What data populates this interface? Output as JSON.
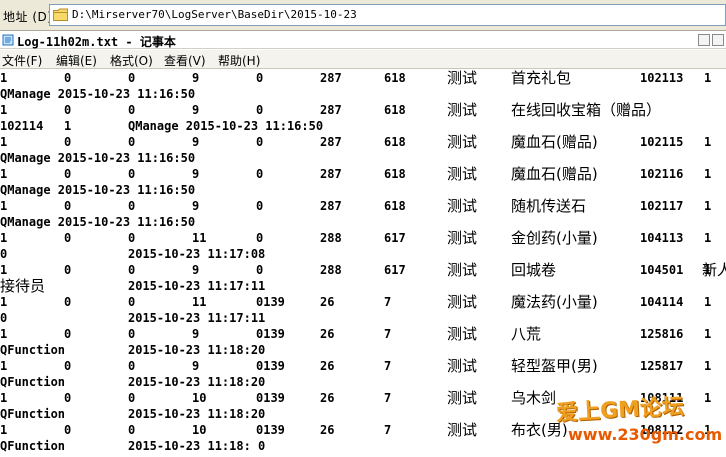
{
  "address_bar": {
    "label": "地址 (D)",
    "path": "D:\\Mirserver70\\LogServer\\BaseDir\\2015-10-23"
  },
  "window": {
    "title": "Log-11h02m.txt - 记事本"
  },
  "menu": [
    {
      "label": "文件(F)"
    },
    {
      "label": "编辑(E)"
    },
    {
      "label": "格式(O)"
    },
    {
      "label": "查看(V)"
    },
    {
      "label": "帮助(H)"
    }
  ],
  "lines": [
    [
      "1",
      "0",
      "0",
      "9",
      "0",
      "287",
      "618",
      "测试",
      "首充礼包",
      "102113",
      "1"
    ],
    [
      "QManage 2015-10-23 11:16:50"
    ],
    [
      "1",
      "0",
      "0",
      "9",
      "0",
      "287",
      "618",
      "测试",
      "在线回收宝箱（赠品）"
    ],
    [
      "102114",
      "1",
      "QManage 2015-10-23 11:16:50"
    ],
    [
      "1",
      "0",
      "0",
      "9",
      "0",
      "287",
      "618",
      "测试",
      "魔血石(赠品)",
      "102115",
      "1"
    ],
    [
      "QManage 2015-10-23 11:16:50"
    ],
    [
      "1",
      "0",
      "0",
      "9",
      "0",
      "287",
      "618",
      "测试",
      "魔血石(赠品)",
      "102116",
      "1"
    ],
    [
      "QManage 2015-10-23 11:16:50"
    ],
    [
      "1",
      "0",
      "0",
      "9",
      "0",
      "287",
      "618",
      "测试",
      "随机传送石",
      "102117",
      "1"
    ],
    [
      "QManage 2015-10-23 11:16:50"
    ],
    [
      "1",
      "0",
      "0",
      "11",
      "0",
      "288",
      "617",
      "测试",
      "金创药(小量)",
      "104113",
      "1"
    ],
    [
      "0",
      "2015-10-23 11:17:08"
    ],
    [
      "1",
      "0",
      "0",
      "9",
      "0",
      "288",
      "617",
      "测试",
      "回城卷",
      "104501",
      "1",
      "新人"
    ],
    [
      "接待员",
      "2015-10-23 11:17:11"
    ],
    [
      "1",
      "0",
      "0",
      "11",
      "0139",
      "26",
      "7",
      "测试",
      "魔法药(小量)",
      "104114",
      "1"
    ],
    [
      "0",
      "2015-10-23 11:17:11"
    ],
    [
      "1",
      "0",
      "0",
      "9",
      "0139",
      "26",
      "7",
      "测试",
      "八荒",
      "125816",
      "1"
    ],
    [
      "QFunction",
      "2015-10-23 11:18:20"
    ],
    [
      "1",
      "0",
      "0",
      "9",
      "0139",
      "26",
      "7",
      "测试",
      "轻型盔甲(男)",
      "125817",
      "1"
    ],
    [
      "QFunction",
      "2015-10-23 11:18:20"
    ],
    [
      "1",
      "0",
      "0",
      "10",
      "0139",
      "26",
      "7",
      "测试",
      "乌木剑",
      "108111",
      "1"
    ],
    [
      "QFunction",
      "2015-10-23 11:18:20"
    ],
    [
      "1",
      "0",
      "0",
      "10",
      "0139",
      "26",
      "7",
      "测试",
      "布衣(男)",
      "108112",
      "1"
    ],
    [
      "QFunction",
      "2015-10-23 11:18: 0"
    ]
  ],
  "watermark": {
    "line1": "爱上GM论坛",
    "line2": "www.230gm.com"
  }
}
